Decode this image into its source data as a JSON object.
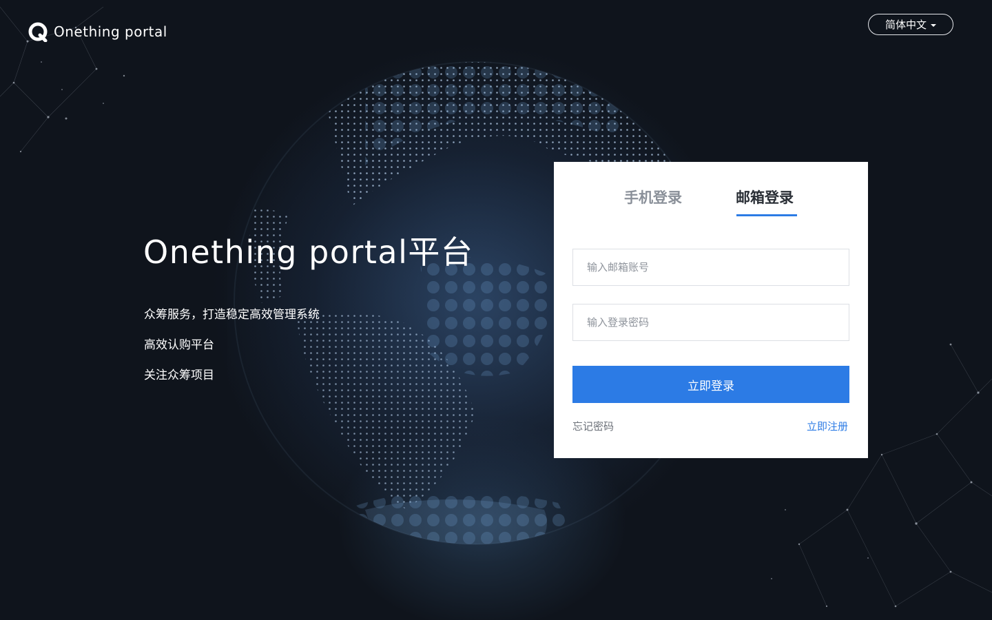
{
  "header": {
    "logo_text": "Onething portal",
    "language_selector": "简体中文"
  },
  "hero": {
    "title": "Onething portal平台",
    "lines": [
      "众筹服务，打造稳定高效管理系统",
      "高效认购平台",
      "关注众筹项目"
    ]
  },
  "login": {
    "tabs": [
      {
        "label": "手机登录",
        "active": false
      },
      {
        "label": "邮箱登录",
        "active": true
      }
    ],
    "email_placeholder": "输入邮箱账号",
    "password_placeholder": "输入登录密码",
    "submit_label": "立即登录",
    "forgot_label": "忘记密码",
    "register_label": "立即注册"
  },
  "colors": {
    "background": "#0f141c",
    "accent": "#2c7be5",
    "card": "#ffffff",
    "tab_inactive": "#8a9099",
    "tab_active": "#2a2f36"
  },
  "icons": {
    "logo": "q-ring-logo-icon",
    "language_caret": "caret-down-icon",
    "background": "dotted-globe-graphic"
  }
}
